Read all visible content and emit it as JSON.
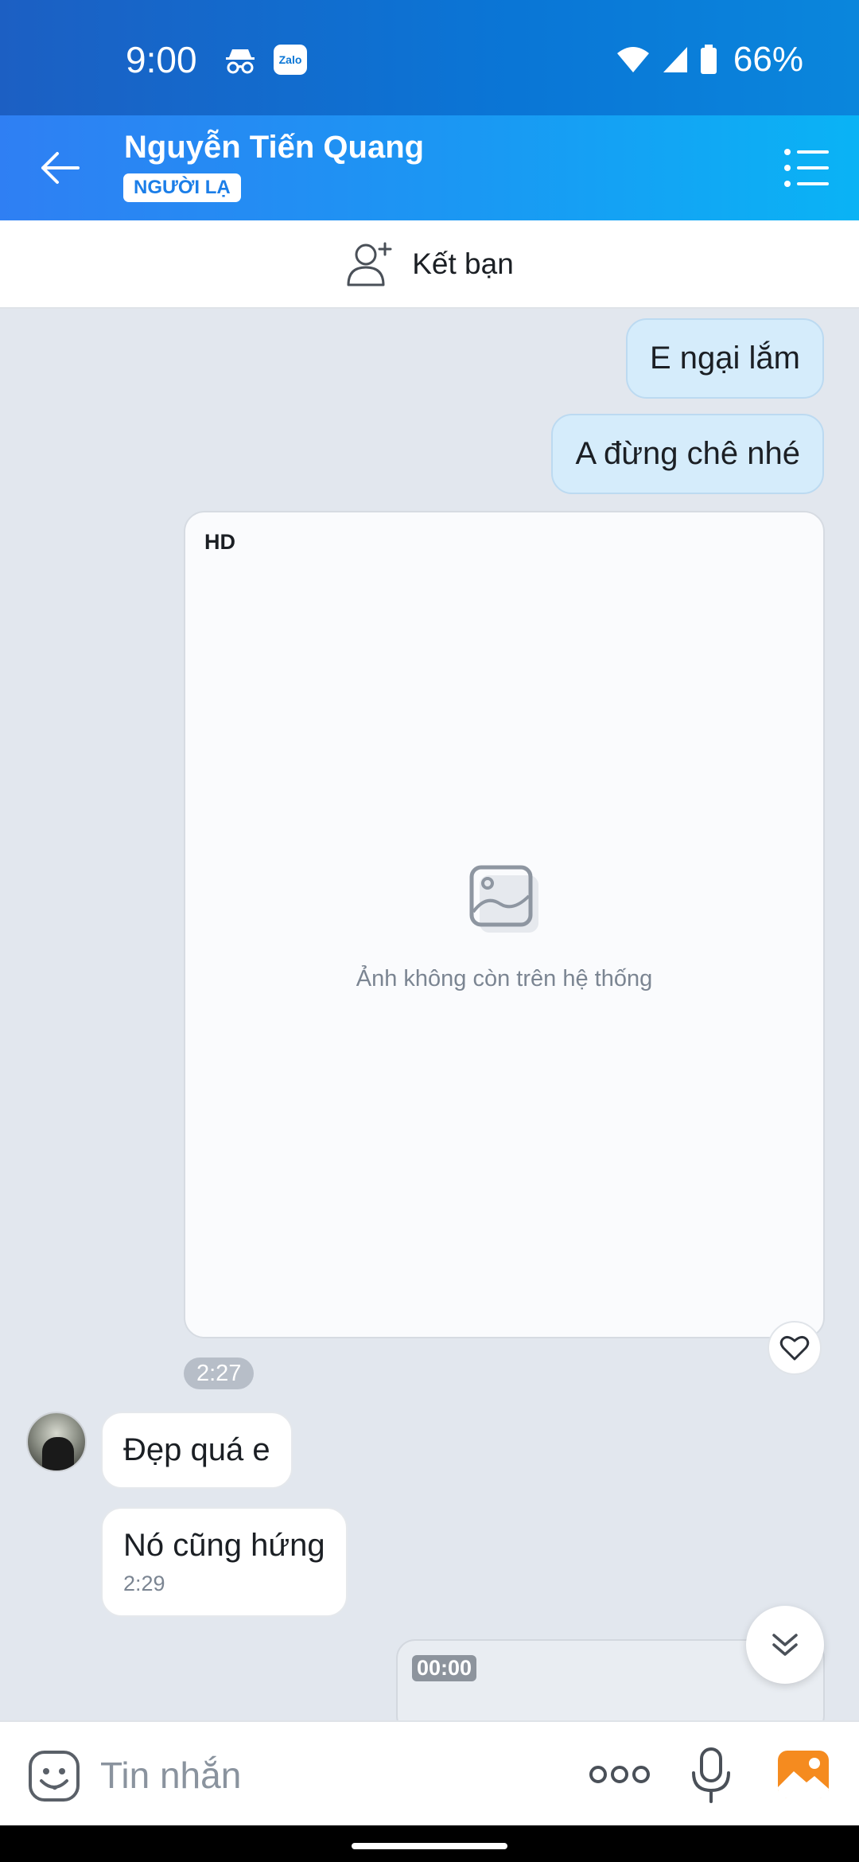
{
  "status_bar": {
    "time": "9:00",
    "zalo_badge": "Zalo",
    "battery": "66%"
  },
  "header": {
    "contact_name": "Nguyễn Tiến Quang",
    "tag": "NGƯỜI LẠ"
  },
  "add_friend": {
    "label": "Kết bạn"
  },
  "messages": {
    "out_1": "E ngại lắm",
    "out_2": "A đừng chê nhé",
    "image": {
      "quality_badge": "HD",
      "missing_text": "Ảnh không còn trên hệ thống",
      "time": "2:27"
    },
    "in_1": "Đẹp quá e",
    "in_2": "Nó cũng hứng",
    "in_2_time": "2:29",
    "video_duration": "00:00"
  },
  "composer": {
    "placeholder": "Tin nhắn"
  },
  "colors": {
    "header_start": "#2f7ff3",
    "header_end": "#0ab3f5",
    "outgoing_bubble": "#d5ecfb",
    "chat_background": "#e2e7ee",
    "gallery_icon": "#f58b1f"
  }
}
